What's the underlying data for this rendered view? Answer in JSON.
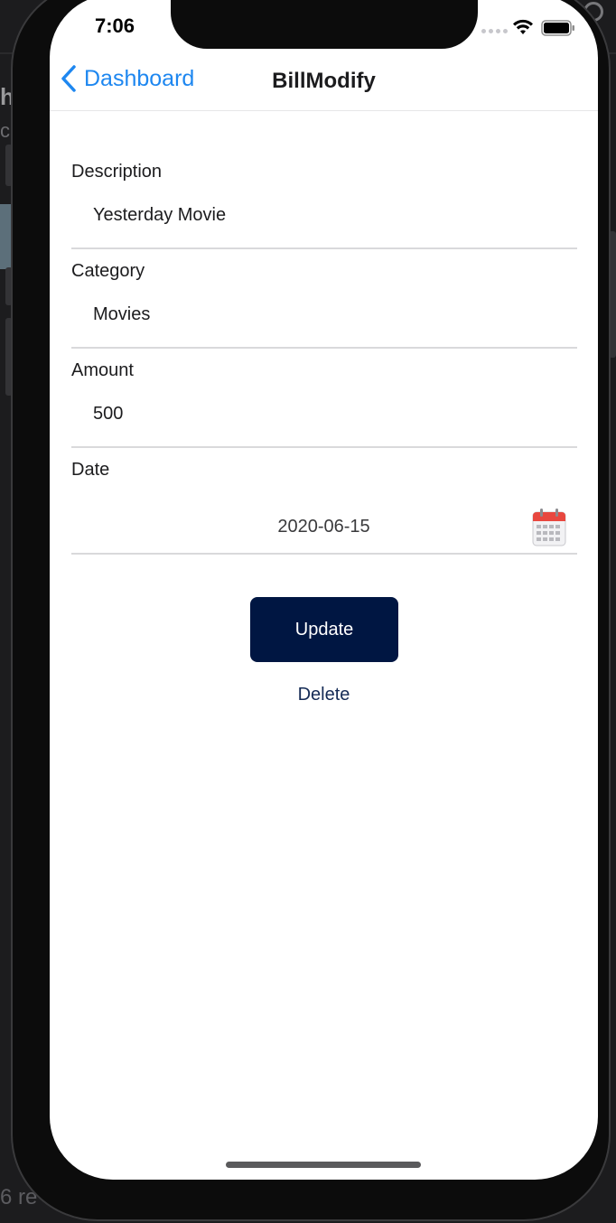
{
  "status_bar": {
    "time": "7:06"
  },
  "navbar": {
    "back_label": "Dashboard",
    "title": "BillModify"
  },
  "form": {
    "description": {
      "label": "Description",
      "value": "Yesterday Movie"
    },
    "category": {
      "label": "Category",
      "value": "Movies"
    },
    "amount": {
      "label": "Amount",
      "value": "500"
    },
    "date": {
      "label": "Date",
      "value": "2020-06-15"
    }
  },
  "actions": {
    "update_label": "Update",
    "delete_label": "Delete"
  },
  "background": {
    "partial_heading": "h",
    "partial_text": "c",
    "partial_footer": "6 re"
  },
  "colors": {
    "accent": "#1e87f0",
    "primary_button": "#001642",
    "delete_text": "#142a55"
  },
  "icons": {
    "back": "chevron-left-icon",
    "wifi": "wifi-icon",
    "battery": "battery-icon",
    "calendar": "calendar-icon"
  }
}
